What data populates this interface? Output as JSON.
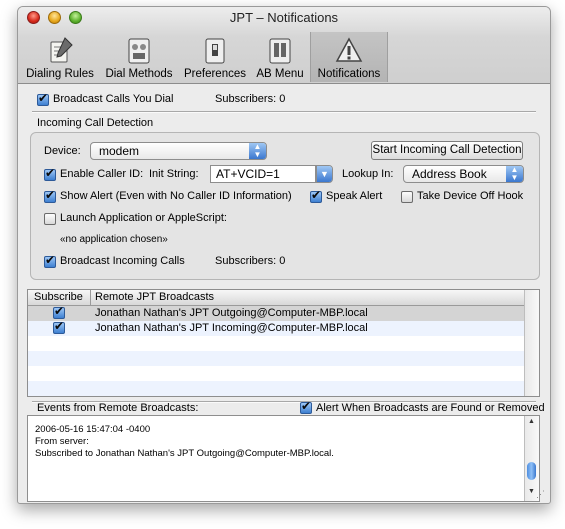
{
  "window": {
    "title": "JPT – Notifications"
  },
  "toolbar": {
    "items": [
      {
        "label": "Dialing Rules",
        "icon": "dialing-rules-icon"
      },
      {
        "label": "Dial Methods",
        "icon": "dial-methods-icon"
      },
      {
        "label": "Preferences",
        "icon": "preferences-icon"
      },
      {
        "label": "AB Menu",
        "icon": "ab-menu-icon"
      },
      {
        "label": "Notifications",
        "icon": "notifications-icon",
        "selected": true
      }
    ]
  },
  "broadcast_dial": {
    "label": "Broadcast Calls You Dial",
    "checked": true,
    "subscribers": "Subscribers: 0"
  },
  "incoming": {
    "group_title": "Incoming Call Detection",
    "device_label": "Device:",
    "device_value": "modem",
    "start_button": "Start Incoming Call Detection",
    "caller_id_label": "Enable Caller ID:",
    "caller_id_checked": true,
    "init_label": "Init String:",
    "init_value": "AT+VCID=1",
    "lookup_label": "Lookup In:",
    "lookup_value": "Address Book",
    "show_alert_label": "Show Alert (Even with No Caller ID Information)",
    "show_alert_checked": true,
    "speak_alert_label": "Speak Alert",
    "speak_alert_checked": true,
    "offhook_label": "Take Device Off Hook",
    "offhook_checked": false,
    "launch_label": "Launch Application or AppleScript:",
    "launch_checked": false,
    "no_app": "«no application chosen»",
    "broadcast_incoming_label": "Broadcast Incoming Calls",
    "broadcast_incoming_checked": true,
    "subscribers": "Subscribers: 0"
  },
  "remote_table": {
    "columns": [
      "Subscribe",
      "Remote JPT Broadcasts"
    ],
    "rows": [
      {
        "subscribed": true,
        "name": "Jonathan Nathan's JPT Outgoing@Computer-MBP.local"
      },
      {
        "subscribed": true,
        "name": "Jonathan Nathan's JPT Incoming@Computer-MBP.local"
      }
    ]
  },
  "events": {
    "label": "Events from Remote Broadcasts:",
    "alert_label": "Alert When Broadcasts are Found or Removed",
    "alert_checked": true,
    "lines": [
      "2006-05-16 15:47:04 -0400",
      "From server:",
      "Subscribed to Jonathan Nathan's JPT Outgoing@Computer-MBP.local."
    ]
  },
  "colors": {
    "selection_row": "#d4d4d4",
    "stripe_row": "#edf3fe",
    "accent": "#3b78cf"
  }
}
